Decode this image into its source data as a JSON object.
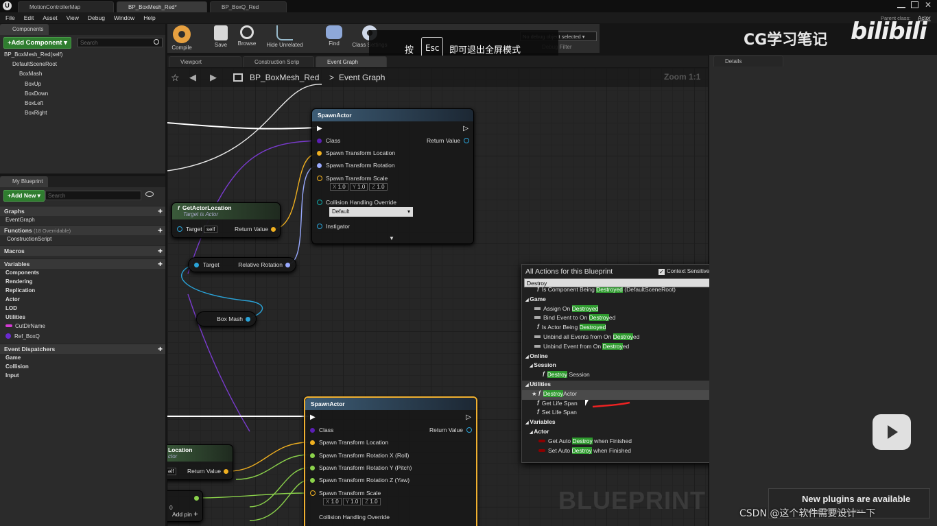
{
  "window": {
    "tabs": [
      "MotionControllerMap",
      "BP_BoxMesh_Red*",
      "BP_BoxQ_Red"
    ],
    "parent_class_label": "Parent class:",
    "parent_class": "Actor"
  },
  "menu": [
    "File",
    "Edit",
    "Asset",
    "View",
    "Debug",
    "Window",
    "Help"
  ],
  "components": {
    "tab": "Components",
    "add_label": "+Add Component ▾",
    "search_placeholder": "Search",
    "self": "BP_BoxMesh_Red(self)",
    "tree": [
      "DefaultSceneRoot",
      "BoxMash",
      "BoxUp",
      "BoxDown",
      "BoxLeft",
      "BoxRight"
    ]
  },
  "my_blueprint": {
    "tab": "My Blueprint",
    "add_label": "+Add New ▾",
    "search_placeholder": "Search",
    "graphs": "Graphs",
    "event_graph": "EventGraph",
    "functions": "Functions",
    "functions_note": "(18 Overridable)",
    "construction": "ConstructionScript",
    "macros": "Macros",
    "variables": "Variables",
    "var_cats": [
      "Components",
      "Rendering",
      "Replication",
      "Actor",
      "LOD",
      "Utilities"
    ],
    "vars": [
      "CutDirName",
      "Ref_BoxQ"
    ],
    "dispatchers": "Event Dispatchers",
    "disp_cats": [
      "Game",
      "Collision",
      "Input"
    ]
  },
  "toolbar": {
    "buttons": [
      "Compile",
      "Save",
      "Browse",
      "Hide Unrelated",
      "Find",
      "Class Settings",
      "C"
    ],
    "debug": "No debug object selected ▾",
    "debug_label": "Debug Filter",
    "overlay": {
      "pre": "按",
      "key": "Esc",
      "post": "即可退出全屏模式"
    },
    "watermark": "CG学习笔记",
    "logo": "bilibili"
  },
  "editor_tabs": [
    "Viewport",
    "Construction Scrip",
    "Event Graph"
  ],
  "breadcrumb": {
    "bp": "BP_BoxMesh_Red",
    "sep": ">",
    "graph": "Event Graph",
    "zoom": "Zoom 1:1"
  },
  "nodes": {
    "spawn1": {
      "title": "SpawnActor",
      "class": "Class",
      "ret": "Return Value",
      "loc": "Spawn Transform Location",
      "rot": "Spawn Transform Rotation",
      "scale": "Spawn Transform Scale",
      "x": "X",
      "xv": "1.0",
      "y": "Y",
      "yv": "1.0",
      "z": "Z",
      "zv": "1.0",
      "coll": "Collision Handling Override",
      "coll_val": "Default",
      "instig": "Instigator"
    },
    "getloc": {
      "title": "GetActorLocation",
      "sub": "Target is Actor",
      "target": "Target",
      "self": "self",
      "ret": "Return Value"
    },
    "relrot": {
      "target": "Target",
      "out": "Relative Rotation"
    },
    "boxmesh": {
      "label": "Box Mash"
    },
    "spawn2": {
      "title": "SpawnActor",
      "class": "Class",
      "ret": "Return Value",
      "loc": "Spawn Transform Location",
      "rotx": "Spawn Transform Rotation X (Roll)",
      "roty": "Spawn Transform Rotation Y (Pitch)",
      "rotz": "Spawn Transform Rotation Z (Yaw)",
      "scale": "Spawn Transform Scale",
      "x": "X",
      "xv": "1.0",
      "y": "Y",
      "yv": "1.0",
      "z": "Z",
      "zv": "1.0",
      "coll": "Collision Handling Override"
    },
    "getloc2": {
      "title": "Location",
      "sub": "ctor",
      "self": "elf",
      "ret": "Return Value"
    },
    "addpin": {
      "label": "Add pin",
      "zero": "0"
    }
  },
  "watermark_bp": "BLUEPRINT",
  "actions": {
    "title": "All Actions for this Blueprint",
    "context": "Context Sensitive",
    "query": "Destroy",
    "items": [
      {
        "type": "fn",
        "pre": "Is Component Being ",
        "hl": "Destroyed",
        "post": " (DefaultSceneRoot)"
      },
      {
        "type": "cat",
        "text": "Game"
      },
      {
        "type": "ev",
        "pre": "Assign On ",
        "hl": "Destroyed",
        "post": ""
      },
      {
        "type": "ev",
        "pre": "Bind Event to On ",
        "hl": "Destroy",
        "post": "ed"
      },
      {
        "type": "fn",
        "pre": "Is Actor Being ",
        "hl": "Destroyed",
        "post": ""
      },
      {
        "type": "ev",
        "pre": "Unbind all Events from On ",
        "hl": "Destroy",
        "post": "ed"
      },
      {
        "type": "ev",
        "pre": "Unbind Event from On ",
        "hl": "Destroy",
        "post": "ed"
      },
      {
        "type": "cat",
        "text": "Online"
      },
      {
        "type": "cat2",
        "text": "Session"
      },
      {
        "type": "fn2",
        "pre": "",
        "hl": "Destroy",
        "post": " Session"
      },
      {
        "type": "sel",
        "text": "Utilities"
      },
      {
        "type": "fnsel",
        "pre": "",
        "hl": "Destroy",
        "post": "Actor"
      },
      {
        "type": "fn",
        "pre": "Get Life Span",
        "hl": "",
        "post": ""
      },
      {
        "type": "fn",
        "pre": "Set Life Span",
        "hl": "",
        "post": ""
      },
      {
        "type": "cat",
        "text": "Variables"
      },
      {
        "type": "cat2",
        "text": "Actor"
      },
      {
        "type": "var",
        "pre": "Get Auto ",
        "hl": "Destroy",
        "post": " when Finished"
      },
      {
        "type": "var",
        "pre": "Set Auto ",
        "hl": "Destroy",
        "post": " when Finished"
      }
    ]
  },
  "details": {
    "tab": "Details"
  },
  "notify": {
    "text": "New plugins are available",
    "sub": "Manage Plugins Dismiss"
  },
  "csdn": "CSDN @这个软件需要设计一下",
  "colors": {
    "exec": "#ffffff",
    "class": "#5b1fb5",
    "vector": "#f0b020",
    "rotator": "#99aaff",
    "object": "#2aa3d8",
    "float": "#8bd24b",
    "accent": "#2e9a2e",
    "select": "#f0b030"
  }
}
